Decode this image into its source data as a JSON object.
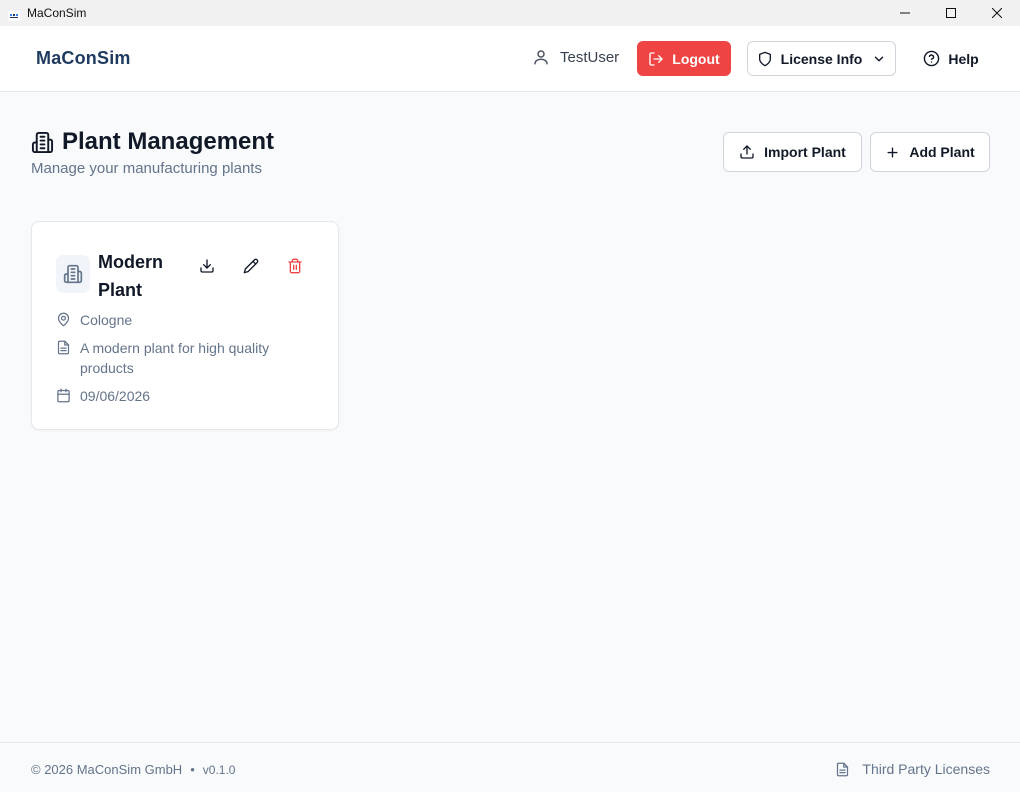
{
  "window": {
    "title": "MaConSim",
    "controls": {
      "minimize_icon": "minimize-icon",
      "maximize_icon": "maximize-icon",
      "close_icon": "close-icon"
    }
  },
  "header": {
    "brand": "MaConSim",
    "user_name": "TestUser",
    "logout_label": "Logout",
    "license_label": "License Info",
    "help_label": "Help"
  },
  "page": {
    "title": "Plant Management",
    "subtitle": "Manage your manufacturing plants",
    "import_label": "Import Plant",
    "add_label": "Add Plant"
  },
  "plants": [
    {
      "name": "Modern Plant",
      "location": "Cologne",
      "description": "A modern plant for high quality products",
      "date": "09/06/2026"
    }
  ],
  "footer": {
    "copyright": "© 2026 MaConSim GmbH",
    "separator": "•",
    "version": "v0.1.0",
    "third_party": "Third Party Licenses"
  },
  "colors": {
    "brand": "#1e3a5f",
    "danger": "#ef4444",
    "muted": "#64748b",
    "border": "#e5e7eb"
  }
}
